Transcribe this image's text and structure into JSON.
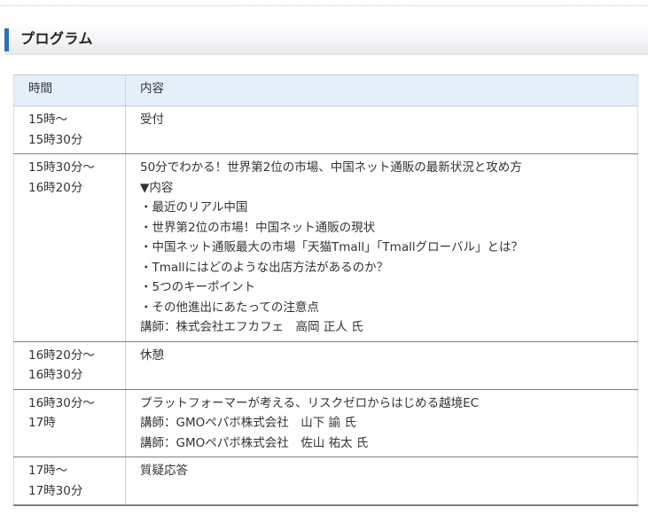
{
  "section": {
    "title": "プログラム"
  },
  "table": {
    "headers": {
      "time": "時間",
      "content": "内容"
    },
    "rows": [
      {
        "time": [
          "15時～",
          "15時30分"
        ],
        "content": [
          "受付"
        ]
      },
      {
        "time": [
          "15時30分～",
          "16時20分"
        ],
        "content": [
          "50分でわかる！世界第2位の市場、中国ネット通販の最新状況と攻め方",
          "▼内容",
          "・最近のリアル中国",
          "・世界第2位の市場！中国ネット通販の現状",
          "・中国ネット通販最大の市場「天猫Tmall」「Tmallグローバル」とは？",
          "・Tmallにはどのような出店方法があるのか？",
          "・5つのキーポイント",
          "・その他進出にあたっての注意点",
          "講師：株式会社エフカフェ　高岡 正人 氏"
        ]
      },
      {
        "time": [
          "16時20分～",
          "16時30分"
        ],
        "content": [
          "休憩"
        ]
      },
      {
        "time": [
          "16時30分～",
          "17時"
        ],
        "content": [
          "プラットフォーマーが考える、リスクゼロからはじめる越境EC",
          "講師：GMOペパボ株式会社　山下 諭 氏",
          "講師：GMOペパボ株式会社　佐山 祐太 氏"
        ]
      },
      {
        "time": [
          "17時～",
          "17時30分"
        ],
        "content": [
          "質疑応答"
        ]
      }
    ]
  }
}
